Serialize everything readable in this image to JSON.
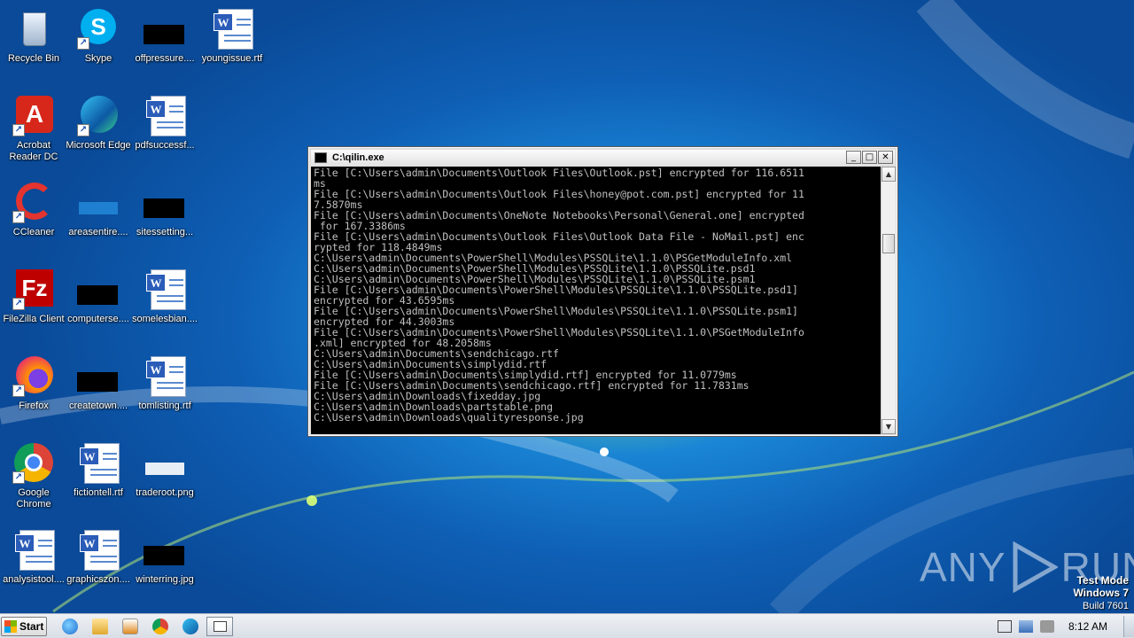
{
  "desktop": {
    "icons": [
      {
        "label": "Recycle Bin",
        "icon": "recycle-bin-icon"
      },
      {
        "label": "Skype",
        "icon": "skype-icon"
      },
      {
        "label": "offpressure....",
        "icon": "image-thumbnail-icon"
      },
      {
        "label": "youngissue.rtf",
        "icon": "word-document-icon"
      },
      {
        "label": "Acrobat Reader DC",
        "icon": "acrobat-icon"
      },
      {
        "label": "Microsoft Edge",
        "icon": "edge-icon"
      },
      {
        "label": "pdfsuccessf...",
        "icon": "word-document-icon"
      },
      {
        "label": "CCleaner",
        "icon": "ccleaner-icon"
      },
      {
        "label": "areasentire....",
        "icon": "image-thumbnail-icon"
      },
      {
        "label": "sitessetting...",
        "icon": "image-thumbnail-icon"
      },
      {
        "label": "FileZilla Client",
        "icon": "filezilla-icon"
      },
      {
        "label": "computerse....",
        "icon": "image-thumbnail-icon"
      },
      {
        "label": "somelesbian....",
        "icon": "word-document-icon"
      },
      {
        "label": "Firefox",
        "icon": "firefox-icon"
      },
      {
        "label": "createtown....",
        "icon": "image-thumbnail-icon"
      },
      {
        "label": "tomlisting.rtf",
        "icon": "word-document-icon"
      },
      {
        "label": "Google Chrome",
        "icon": "chrome-icon"
      },
      {
        "label": "fictiontell.rtf",
        "icon": "word-document-icon"
      },
      {
        "label": "traderoot.png",
        "icon": "image-thumbnail-icon"
      },
      {
        "label": "analysistool....",
        "icon": "word-document-icon"
      },
      {
        "label": "graphicszon....",
        "icon": "word-document-icon"
      },
      {
        "label": "winterring.jpg",
        "icon": "image-thumbnail-icon"
      }
    ]
  },
  "console_window": {
    "title": "C:\\qilin.exe",
    "minimize": "_",
    "maximize": "□",
    "close": "✕",
    "lines": [
      "File [C:\\Users\\admin\\Documents\\Outlook Files\\Outlook.pst] encrypted for 116.6511",
      "ms",
      "File [C:\\Users\\admin\\Documents\\Outlook Files\\honey@pot.com.pst] encrypted for 11",
      "7.5870ms",
      "File [C:\\Users\\admin\\Documents\\OneNote Notebooks\\Personal\\General.one] encrypted",
      " for 167.3386ms",
      "File [C:\\Users\\admin\\Documents\\Outlook Files\\Outlook Data File - NoMail.pst] enc",
      "rypted for 118.4849ms",
      "C:\\Users\\admin\\Documents\\PowerShell\\Modules\\PSSQLite\\1.1.0\\PSGetModuleInfo.xml",
      "C:\\Users\\admin\\Documents\\PowerShell\\Modules\\PSSQLite\\1.1.0\\PSSQLite.psd1",
      "C:\\Users\\admin\\Documents\\PowerShell\\Modules\\PSSQLite\\1.1.0\\PSSQLite.psm1",
      "File [C:\\Users\\admin\\Documents\\PowerShell\\Modules\\PSSQLite\\1.1.0\\PSSQLite.psd1]",
      "encrypted for 43.6595ms",
      "File [C:\\Users\\admin\\Documents\\PowerShell\\Modules\\PSSQLite\\1.1.0\\PSSQLite.psm1]",
      "encrypted for 44.3003ms",
      "File [C:\\Users\\admin\\Documents\\PowerShell\\Modules\\PSSQLite\\1.1.0\\PSGetModuleInfo",
      ".xml] encrypted for 48.2058ms",
      "C:\\Users\\admin\\Documents\\sendchicago.rtf",
      "C:\\Users\\admin\\Documents\\simplydid.rtf",
      "File [C:\\Users\\admin\\Documents\\simplydid.rtf] encrypted for 11.0779ms",
      "File [C:\\Users\\admin\\Documents\\sendchicago.rtf] encrypted for 11.7831ms",
      "C:\\Users\\admin\\Downloads\\fixedday.jpg",
      "C:\\Users\\admin\\Downloads\\partstable.png",
      "C:\\Users\\admin\\Downloads\\qualityresponse.jpg"
    ]
  },
  "watermark": {
    "brand_left": "ANY",
    "brand_right": "RUN",
    "mode": "Test Mode",
    "os": "Windows 7",
    "build": "Build 7601"
  },
  "taskbar": {
    "start_label": "Start",
    "clock": "8:12 AM",
    "pinned": [
      "ie-icon",
      "explorer-icon",
      "media-player-icon",
      "chrome-icon",
      "edge-icon",
      "console-icon"
    ]
  },
  "colors": {
    "console_text": "#c0c0c0",
    "console_bg": "#000000",
    "desktop_blue": "#1a86d6"
  }
}
